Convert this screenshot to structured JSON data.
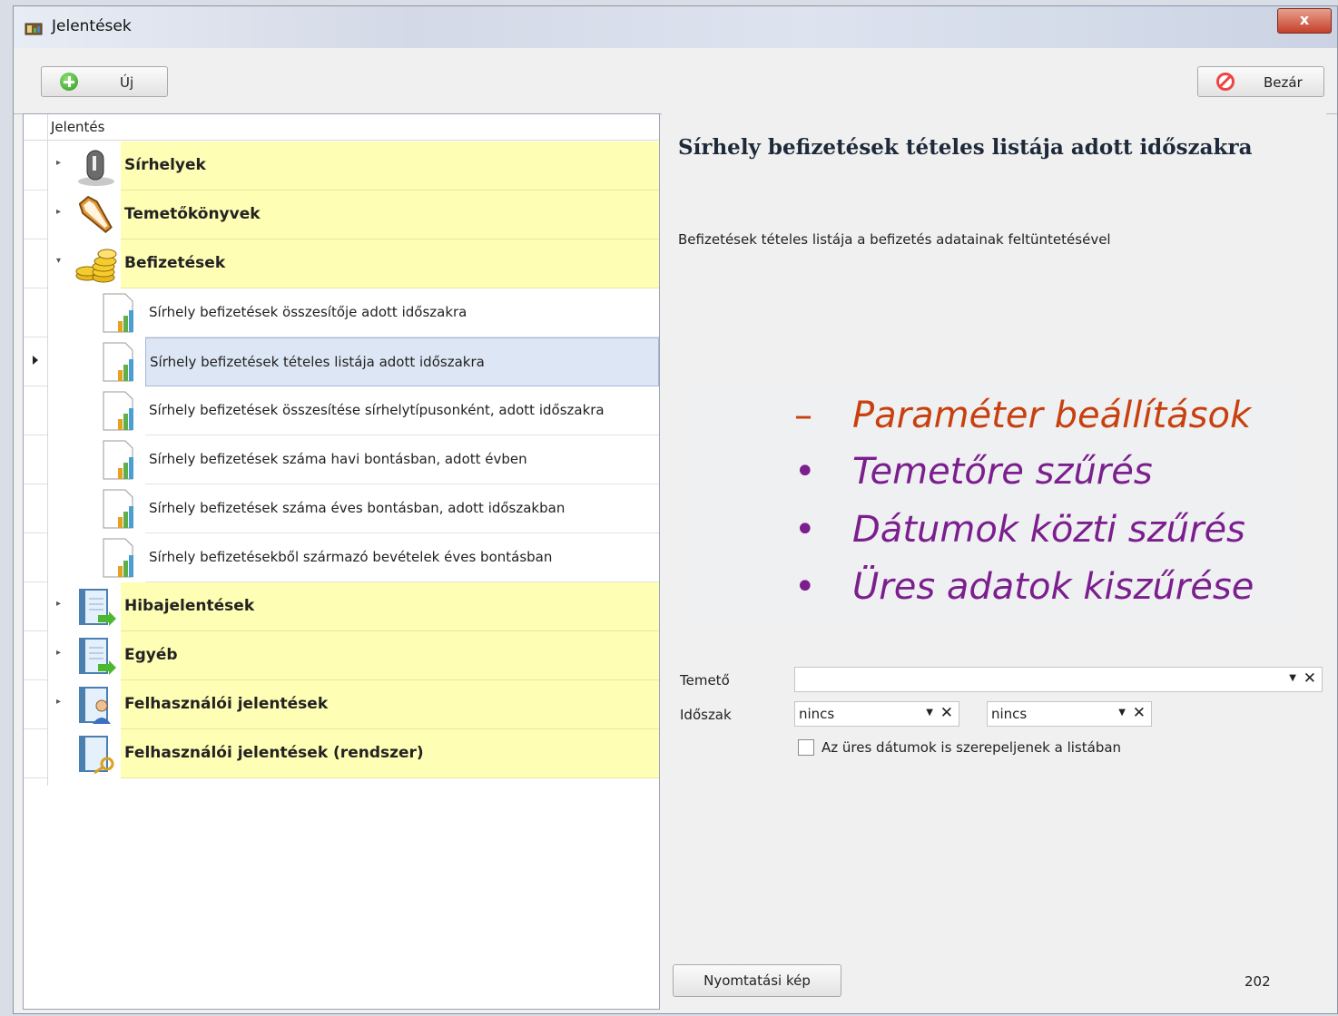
{
  "window": {
    "title": "Jelentések",
    "close_glyph": "x"
  },
  "toolbar": {
    "new_label": "Új",
    "close_label": "Bezár"
  },
  "tree": {
    "header": "Jelentés",
    "categories": [
      {
        "label": "Sírhelyek",
        "icon": "tombstone-icon"
      },
      {
        "label": "Temetőkönyvek",
        "icon": "coffin-icon"
      },
      {
        "label": "Befizetések",
        "icon": "coins-icon"
      },
      {
        "label": "Hibajelentések",
        "icon": "report-notebook-icon"
      },
      {
        "label": "Egyéb",
        "icon": "report-notebook-icon"
      },
      {
        "label": "Felhasználói jelentések",
        "icon": "user-report-icon"
      },
      {
        "label": "Felhasználói jelentések (rendszer)",
        "icon": "key-report-icon"
      }
    ],
    "sub_items": [
      "Sírhely befizetések összesítője adott időszakra",
      "Sírhely befizetések tételes listája adott időszakra",
      "Sírhely befizetések összesítése sírhelytípusonként, adott időszakra",
      "Sírhely befizetések száma havi bontásban, adott évben",
      "Sírhely befizetések száma éves bontásban, adott időszakban",
      "Sírhely befizetésekből származó bevételek éves bontásban"
    ],
    "selected_index": 1
  },
  "detail": {
    "title": "Sírhely befizetések tételes listája adott időszakra",
    "description": "Befizetések tételes listája a befizetés adatainak feltüntetésével"
  },
  "overlay": {
    "heading_bullet": "–",
    "heading": "Paraméter beállítások",
    "bullet": "•",
    "items": [
      "Temetőre szűrés",
      "Dátumok közti szűrés",
      "Üres adatok kiszűrése"
    ],
    "heading_color": "#c8400e",
    "item_color": "#7b1e8e"
  },
  "form": {
    "temeto_label": "Temető",
    "temeto_value": "",
    "idoszak_label": "Időszak",
    "from_value": "nincs",
    "to_value": "nincs",
    "checkbox_label": "Az üres dátumok is szerepeljenek a listában",
    "dropdown_glyph": "▼",
    "clear_glyph": "✕"
  },
  "footer": {
    "print_label": "Nyomtatási kép",
    "count": "202"
  }
}
